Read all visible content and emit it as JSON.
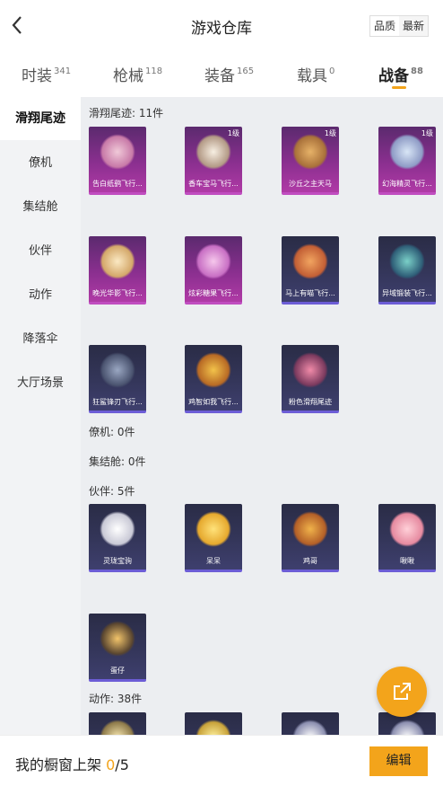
{
  "header": {
    "title": "游戏仓库",
    "sort": {
      "option1": "品质",
      "option2": "最新"
    }
  },
  "tabs": [
    {
      "label": "时装",
      "count": "341"
    },
    {
      "label": "枪械",
      "count": "118"
    },
    {
      "label": "装备",
      "count": "165"
    },
    {
      "label": "载具",
      "count": "0"
    },
    {
      "label": "战备",
      "count": "88"
    }
  ],
  "sidebar": {
    "items": [
      "滑翔尾迹",
      "僚机",
      "集结舱",
      "伙伴",
      "动作",
      "降落伞",
      "大厅场景"
    ]
  },
  "sections": {
    "glide": {
      "title": "滑翔尾迹: 11件"
    },
    "wingman": {
      "title": "僚机: 0件"
    },
    "pod": {
      "title": "集结舱: 0件"
    },
    "partner": {
      "title": "伙伴: 5件"
    },
    "action": {
      "title": "动作: 38件"
    }
  },
  "glide_items": [
    {
      "name": "告白纸鹞飞行...",
      "level": ""
    },
    {
      "name": "香车宝马飞行...",
      "level": "1级"
    },
    {
      "name": "沙丘之主天马",
      "level": "1级"
    },
    {
      "name": "幻海精灵飞行...",
      "level": "1级"
    },
    {
      "name": "晚光华影飞行...",
      "level": ""
    },
    {
      "name": "炫彩糖果飞行...",
      "level": ""
    },
    {
      "name": "马上有喵飞行...",
      "level": ""
    },
    {
      "name": "异域锻装飞行...",
      "level": ""
    },
    {
      "name": "狂鲨锋刃飞行...",
      "level": ""
    },
    {
      "name": "鸡智如我飞行...",
      "level": ""
    },
    {
      "name": "粉色滑翔尾迹",
      "level": ""
    }
  ],
  "partner_items": [
    {
      "name": "灵珑宝驹"
    },
    {
      "name": "呆呆"
    },
    {
      "name": "鸡哥"
    },
    {
      "name": "啾啾"
    },
    {
      "name": "蛋仔"
    }
  ],
  "footer": {
    "label": "我的橱窗上架",
    "current": "0",
    "total": "/5",
    "edit": "编辑"
  }
}
